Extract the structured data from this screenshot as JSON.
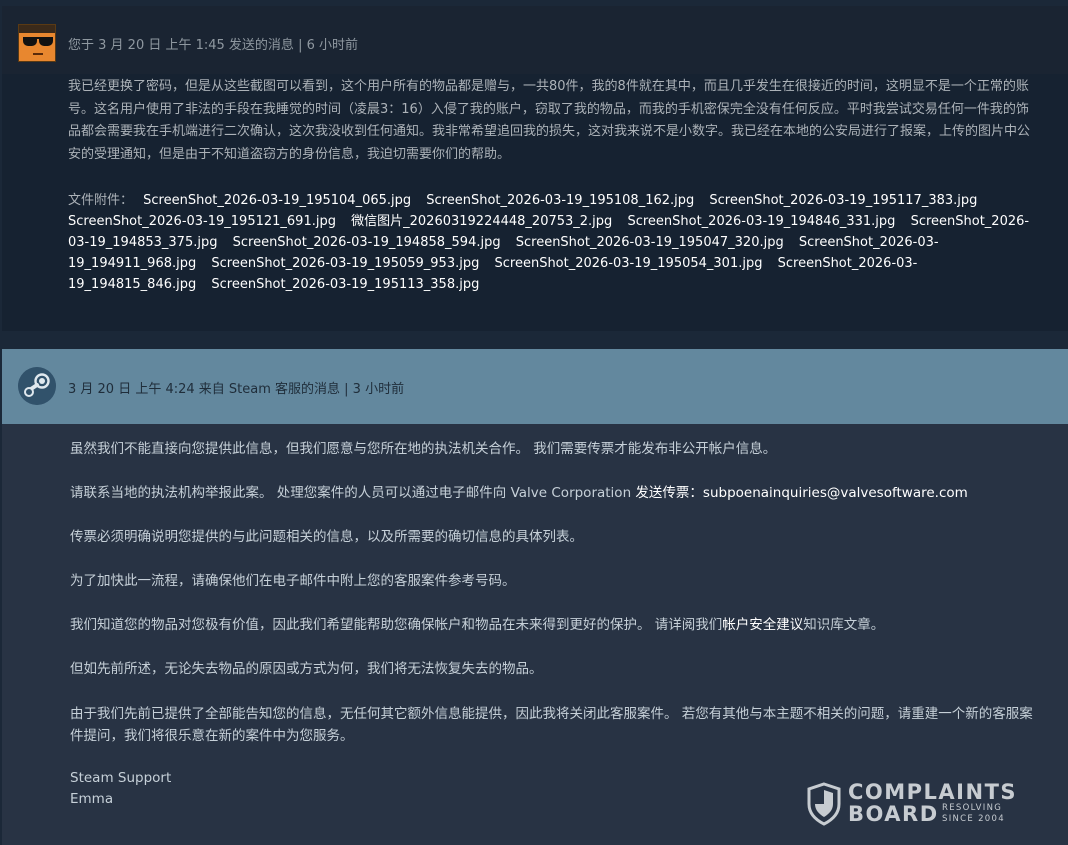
{
  "message1": {
    "header": "您于 3 月 20 日 上午 1:45 发送的消息 | 6 小时前",
    "body": "我已经更换了密码，但是从这些截图可以看到，这个用户所有的物品都是赠与，一共80件，我的8件就在其中，而且几乎发生在很接近的时间，这明显不是一个正常的账号。这名用户使用了非法的手段在我睡觉的时间（凌晨3：16）入侵了我的账户，窃取了我的物品，而我的手机密保完全没有任何反应。平时我尝试交易任何一件我的饰品都会需要我在手机端进行二次确认，这次我没收到任何通知。我非常希望追回我的损失，这对我来说不是小数字。我已经在本地的公安局进行了报案，上传的图片中公安的受理通知，但是由于不知道盗窃方的身份信息，我迫切需要你们的帮助。",
    "attachments_label": "文件附件：",
    "attachments": [
      "ScreenShot_2026-03-19_195104_065.jpg",
      "ScreenShot_2026-03-19_195108_162.jpg",
      "ScreenShot_2026-03-19_195117_383.jpg",
      "ScreenShot_2026-03-19_195121_691.jpg",
      "微信图片_20260319224448_20753_2.jpg",
      "ScreenShot_2026-03-19_194846_331.jpg",
      "ScreenShot_2026-03-19_194853_375.jpg",
      "ScreenShot_2026-03-19_194858_594.jpg",
      "ScreenShot_2026-03-19_195047_320.jpg",
      "ScreenShot_2026-03-19_194911_968.jpg",
      "ScreenShot_2026-03-19_195059_953.jpg",
      "ScreenShot_2026-03-19_195054_301.jpg",
      "ScreenShot_2026-03-19_194815_846.jpg",
      "ScreenShot_2026-03-19_195113_358.jpg"
    ]
  },
  "message2": {
    "header": "3 月 20 日 上午 4:24 来自 Steam 客服的消息 | 3 小时前",
    "p1": "虽然我们不能直接向您提供此信息，但我们愿意与您所在地的执法机关合作。 我们需要传票才能发布非公开帐户信息。",
    "p2_prefix": "请联系当地的执法机构举报此案。 处理您案件的人员可以通过电子邮件向 Valve Corporation ",
    "p2_emph": "发送传票：subpoenainquiries@valvesoftware.com",
    "p3": "传票必须明确说明您提供的与此问题相关的信息，以及所需要的确切信息的具体列表。",
    "p4": "为了加快此一流程，请确保他们在电子邮件中附上您的客服案件参考号码。",
    "p5_prefix": "我们知道您的物品对您极有价值，因此我们希望能帮助您确保帐户和物品在未来得到更好的保护。 请详阅我们",
    "p5_link": "帐户安全建议",
    "p5_suffix": "知识库文章。",
    "p6": "但如先前所述，无论失去物品的原因或方式为何，我们将无法恢复失去的物品。",
    "p7": "由于我们先前已提供了全部能告知您的信息，无任何其它额外信息能提供，因此我将关闭此客服案件。 若您有其他与本主题不相关的问题，请重建一个新的客服案件提问，我们将很乐意在新的案件中为您服务。",
    "sig1": "Steam Support",
    "sig2": "Emma"
  },
  "watermark": {
    "line1": "COMPLAINTS",
    "line2": "BOARD",
    "line3a": "RESOLVING",
    "line3b": "SINCE 2004"
  }
}
